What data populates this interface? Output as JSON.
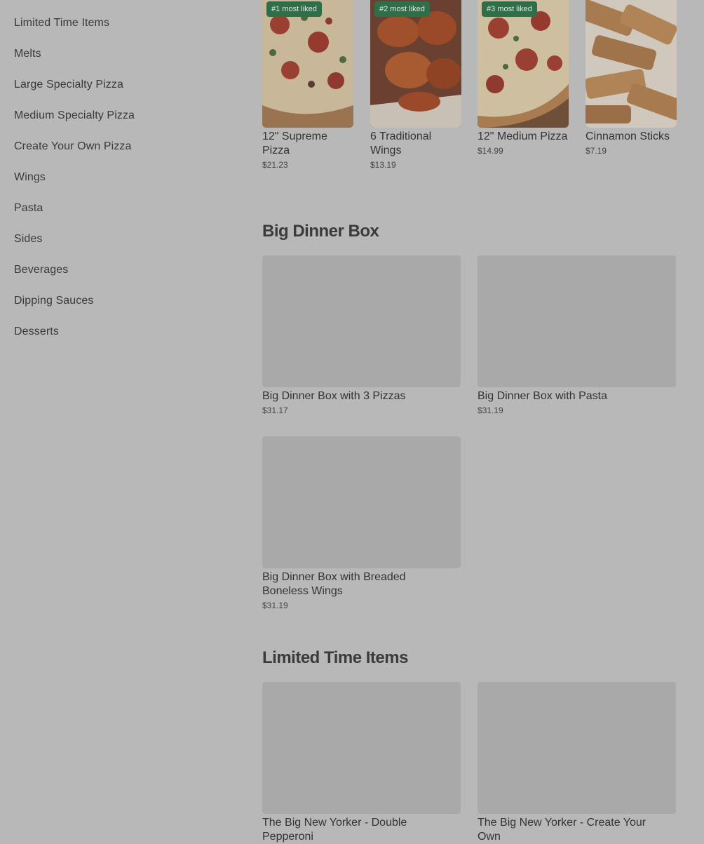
{
  "sidebar": {
    "categories": [
      "Limited Time Items",
      "Melts",
      "Large Specialty Pizza",
      "Medium Specialty Pizza",
      "Create Your Own Pizza",
      "Wings",
      "Pasta",
      "Sides",
      "Beverages",
      "Dipping Sauces",
      "Desserts"
    ]
  },
  "popular": [
    {
      "badge": "#1 most liked",
      "name": "12\" Supreme Pizza",
      "price": "$21.23"
    },
    {
      "badge": "#2 most liked",
      "name": "6 Traditional Wings",
      "price": "$13.19"
    },
    {
      "badge": "#3 most liked",
      "name": "12\" Medium Pizza",
      "price": "$14.99"
    },
    {
      "badge": "",
      "name": "Cinnamon Sticks",
      "price": "$7.19"
    }
  ],
  "big_dinner_box": {
    "title": "Big Dinner Box",
    "items": [
      {
        "name": "Big Dinner Box with 3 Pizzas",
        "price": "$31.17"
      },
      {
        "name": "Big Dinner Box with Pasta",
        "price": "$31.19"
      },
      {
        "name": "Big Dinner Box with Breaded Boneless Wings",
        "price": "$31.19"
      }
    ]
  },
  "limited_time": {
    "title": "Limited Time Items",
    "items": [
      {
        "name": "The Big New Yorker - Double Pepperoni",
        "price": ""
      },
      {
        "name": "The Big New Yorker - Create Your Own",
        "price": ""
      }
    ]
  }
}
